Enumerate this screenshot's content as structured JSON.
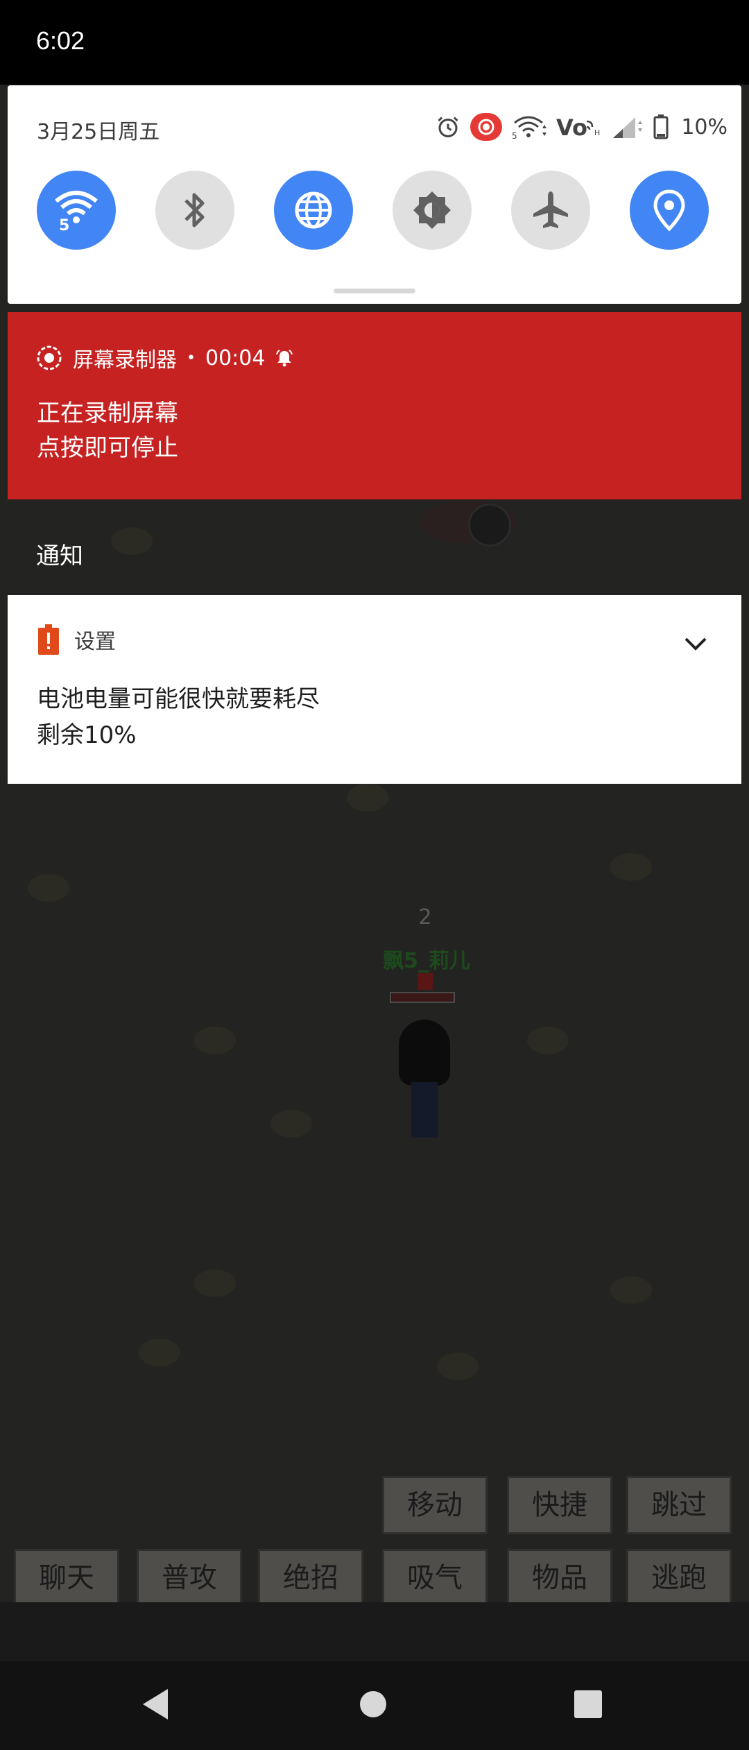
{
  "status_bar": {
    "time": "6:02"
  },
  "quick_settings": {
    "date": "3月25日周五",
    "battery_percent": "10%",
    "status_icons": [
      "alarm-icon",
      "screen-record-icon",
      "wifi-icon",
      "volte-icon",
      "cell-signal-icon",
      "battery-icon"
    ],
    "tiles": [
      {
        "name": "wifi",
        "icon": "wifi-icon",
        "state": "on",
        "badge": "5"
      },
      {
        "name": "bluetooth",
        "icon": "bluetooth-icon",
        "state": "off"
      },
      {
        "name": "mobile-data",
        "icon": "globe-icon",
        "state": "on"
      },
      {
        "name": "auto-brightness",
        "icon": "brightness-icon",
        "state": "off"
      },
      {
        "name": "airplane-mode",
        "icon": "airplane-icon",
        "state": "off"
      },
      {
        "name": "location",
        "icon": "location-pin-icon",
        "state": "on"
      }
    ],
    "accent": "#4285f4"
  },
  "screen_recorder": {
    "app_name": "屏幕录制器",
    "separator": "•",
    "elapsed": "00:04",
    "title": "正在录制屏幕",
    "subtitle": "点按即可停止",
    "color": "#c62222"
  },
  "notifications_header": "通知",
  "battery_notification": {
    "app_name": "设置",
    "title": "电池电量可能很快就要耗尽",
    "subtitle": "剩余10%",
    "icon_color": "#e04a1b"
  },
  "game": {
    "character_level": "2",
    "character_name": "飘5_莉儿",
    "buttons_top": [
      "移动",
      "快捷",
      "跳过"
    ],
    "buttons_bottom": [
      "聊天",
      "普攻",
      "绝招",
      "吸气",
      "物品",
      "逃跑"
    ]
  },
  "nav_bar": {
    "buttons": [
      "back-icon",
      "home-icon",
      "recents-icon"
    ]
  }
}
